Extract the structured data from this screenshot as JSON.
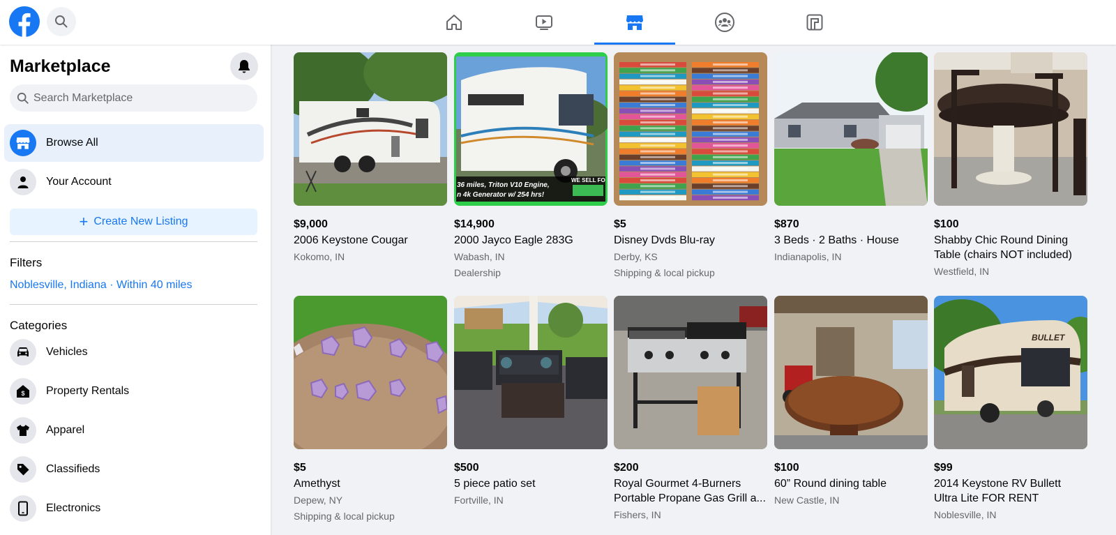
{
  "topbar": {
    "brand_color": "#1877f2",
    "logo_icon": "facebook-logo-icon",
    "search_icon": "search-icon",
    "tabs": [
      {
        "name": "home",
        "icon": "home-icon"
      },
      {
        "name": "watch",
        "icon": "video-icon"
      },
      {
        "name": "marketplace",
        "icon": "shop-icon",
        "active": true
      },
      {
        "name": "groups",
        "icon": "groups-icon"
      },
      {
        "name": "gaming",
        "icon": "gaming-icon"
      }
    ]
  },
  "sidebar": {
    "title": "Marketplace",
    "search_placeholder": "Search Marketplace",
    "nav": [
      {
        "label": "Browse All",
        "icon": "shop-icon",
        "active": true
      },
      {
        "label": "Your Account",
        "icon": "person-icon"
      }
    ],
    "create_label": "Create New Listing",
    "filters_heading": "Filters",
    "location_filter": "Noblesville, Indiana · Within 40 miles",
    "categories_heading": "Categories",
    "categories": [
      {
        "label": "Vehicles",
        "icon": "car-icon"
      },
      {
        "label": "Property Rentals",
        "icon": "house-icon"
      },
      {
        "label": "Apparel",
        "icon": "shirt-icon"
      },
      {
        "label": "Classifieds",
        "icon": "tag-icon"
      },
      {
        "label": "Electronics",
        "icon": "phone-icon"
      }
    ]
  },
  "listings": [
    {
      "price": "$9,000",
      "title": "2006 Keystone Cougar",
      "location": "Kokomo, IN",
      "extra": "",
      "image": "camper-trailer"
    },
    {
      "price": "$14,900",
      "title": "2000 Jayco Eagle 283G",
      "location": "Wabash, IN",
      "extra": "Dealership",
      "image": "motorhome",
      "banner_lines": [
        "36 miles, Triton V10 Engine,",
        "n 4k Generator w/ 254 hrs!"
      ],
      "banner_tag": "WE SELL FO"
    },
    {
      "price": "$5",
      "title": "Disney Dvds Blu-ray",
      "location": "Derby, KS",
      "extra": "Shipping & local pickup",
      "image": "dvd-stacks"
    },
    {
      "price": "$870",
      "title": "3 Beds · 2 Baths · House",
      "location": "Indianapolis, IN",
      "extra": "",
      "image": "house"
    },
    {
      "price": "$100",
      "title": "Shabby Chic Round Dining Table (chairs NOT included)",
      "location": "Westfield, IN",
      "extra": "",
      "image": "dining-table"
    },
    {
      "price": "$5",
      "title": "Amethyst",
      "location": "Depew, NY",
      "extra": "Shipping & local pickup",
      "image": "amethyst"
    },
    {
      "price": "$500",
      "title": "5 piece patio set",
      "location": "Fortville, IN",
      "extra": "",
      "image": "patio-set"
    },
    {
      "price": "$200",
      "title": "Royal Gourmet 4-Burners Portable Propane Gas Grill a...",
      "location": "Fishers, IN",
      "extra": "",
      "image": "gas-grill"
    },
    {
      "price": "$100",
      "title": "60” Round dining table",
      "location": "New Castle, IN",
      "extra": "",
      "image": "garage-table"
    },
    {
      "price": "$99",
      "title": "2014 Keystone RV Bullett Ultra Lite FOR RENT",
      "location": "Noblesville, IN",
      "extra": "",
      "image": "rv-trailer",
      "badge_text": "BULLET"
    }
  ]
}
